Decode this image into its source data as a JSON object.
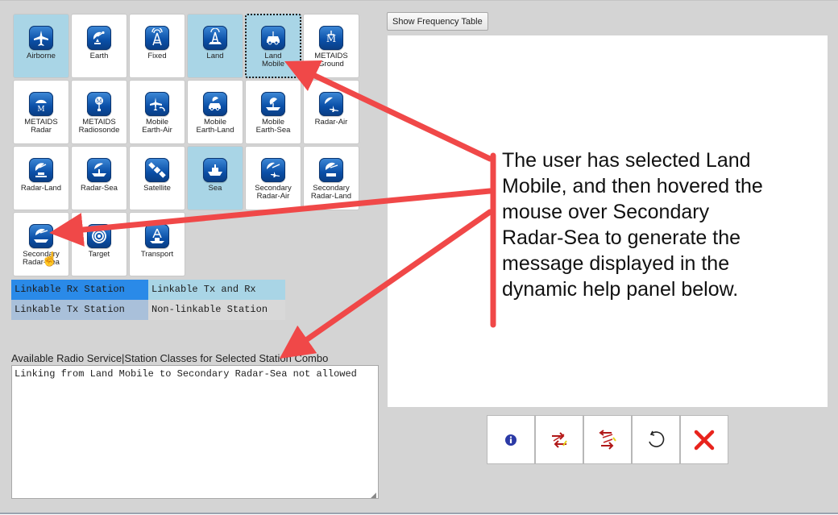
{
  "tiles": [
    {
      "label": "Airborne",
      "icon": "airplane-icon",
      "state": "rx"
    },
    {
      "label": "Earth",
      "icon": "satellite-dish-icon",
      "state": "none"
    },
    {
      "label": "Fixed",
      "icon": "antenna-tower-icon",
      "state": "none"
    },
    {
      "label": "Land",
      "icon": "land-antenna-icon",
      "state": "rx"
    },
    {
      "label": "Land\nMobile",
      "icon": "car-icon",
      "state": "selected"
    },
    {
      "label": "METAIDS\nGround",
      "icon": "metaids-ground-icon",
      "state": "none"
    },
    {
      "label": "METAIDS\nRadar",
      "icon": "metaids-radar-icon",
      "state": "none"
    },
    {
      "label": "METAIDS\nRadiosonde",
      "icon": "radiosonde-icon",
      "state": "none"
    },
    {
      "label": "Mobile\nEarth-Air",
      "icon": "mobile-earth-air-icon",
      "state": "none"
    },
    {
      "label": "Mobile\nEarth-Land",
      "icon": "mobile-earth-land-icon",
      "state": "none"
    },
    {
      "label": "Mobile\nEarth-Sea",
      "icon": "mobile-earth-sea-icon",
      "state": "none"
    },
    {
      "label": "Radar-Air",
      "icon": "radar-air-icon",
      "state": "none"
    },
    {
      "label": "Radar-Land",
      "icon": "radar-land-icon",
      "state": "none"
    },
    {
      "label": "Radar-Sea",
      "icon": "radar-sea-icon",
      "state": "none"
    },
    {
      "label": "Satellite",
      "icon": "satellite-icon",
      "state": "none"
    },
    {
      "label": "Sea",
      "icon": "ship-icon",
      "state": "rx"
    },
    {
      "label": "Secondary\nRadar-Air",
      "icon": "secondary-radar-air-icon",
      "state": "none"
    },
    {
      "label": "Secondary\nRadar-Land",
      "icon": "secondary-radar-land-icon",
      "state": "none"
    },
    {
      "label": "Secondary\nRadar-Sea",
      "icon": "secondary-radar-sea-icon",
      "state": "hovered"
    },
    {
      "label": "Target",
      "icon": "target-icon",
      "state": "none"
    },
    {
      "label": "Transport",
      "icon": "transport-icon",
      "state": "none"
    }
  ],
  "legend": {
    "rx": "Linkable Rx Station",
    "both": "Linkable Tx and Rx",
    "tx": "Linkable Tx Station",
    "non": "Non-linkable Station"
  },
  "help": {
    "title": "Available Radio Service|Station Classes for Selected Station Combo",
    "text": "Linking from Land Mobile to Secondary Radar-Sea not allowed"
  },
  "frequency_button": "Show Frequency Table",
  "toolbar": [
    {
      "name": "info-button",
      "icon": "info-icon"
    },
    {
      "name": "link-forward-button",
      "icon": "link-forward-icon"
    },
    {
      "name": "link-reverse-button",
      "icon": "link-reverse-icon"
    },
    {
      "name": "reset-button",
      "icon": "rotate-icon"
    },
    {
      "name": "delete-button",
      "icon": "x-icon"
    }
  ],
  "annotation": "The user has selected Land Mobile, and then hovered the mouse over Secondary Radar-Sea to generate the message displayed in the dynamic help panel below.",
  "colors": {
    "linkable_rx": "#2a8ae8",
    "linkable_tx_rx": "#a9d5e6",
    "linkable_tx": "#a9c0da",
    "non_linkable": "#d8d8d8",
    "annotation_arrow": "#f04848",
    "delete_red": "#e8231c"
  }
}
